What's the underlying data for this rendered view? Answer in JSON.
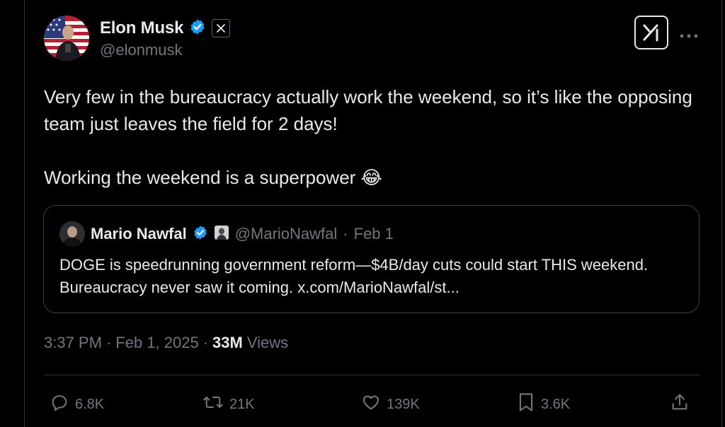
{
  "tweet": {
    "author_name": "Elon Musk",
    "author_handle": "@elonmusk",
    "text_paragraphs": [
      "Very few in the bureaucracy actually work the weekend, so it’s like the opposing team just leaves the field for 2 days!",
      "Working the weekend is a superpower 😂"
    ],
    "time": "3:37 PM",
    "date": "Feb 1, 2025",
    "views_count": "33M",
    "views_label": "Views"
  },
  "quote": {
    "author_name": "Mario Nawfal",
    "author_handle": "@MarioNawfal",
    "date": "Feb 1",
    "text": "DOGE is speedrunning government reform—$4B/day cuts could start THIS weekend. Bureaucracy never saw it coming. x.com/MarioNawfal/st..."
  },
  "actions": {
    "replies": "6.8K",
    "reposts": "21K",
    "likes": "139K",
    "bookmarks": "3.6K"
  },
  "colors": {
    "background": "#000000",
    "text": "#e7e9ea",
    "secondary": "#71767b",
    "verified": "#1d9bf0",
    "border": "#2f3336"
  },
  "icons": [
    "verified-badge-icon",
    "x-affiliate-badge-icon",
    "grok-icon",
    "more-icon",
    "reply-icon",
    "repost-icon",
    "like-icon",
    "bookmark-icon",
    "share-icon"
  ]
}
